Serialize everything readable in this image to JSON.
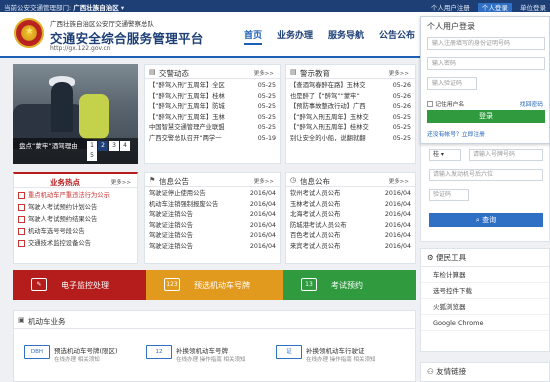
{
  "topbar": {
    "dept_label": "当前公安交通管理部门:",
    "dept_value": "广西壮族自治区",
    "links": [
      "个人用户注册",
      "个人登录",
      "单位登录"
    ]
  },
  "header": {
    "sub": "广西壮族自治区公安厅交通警察总队",
    "name": "交通安全综合服务管理平台",
    "url": "http://gx.122.gov.cn",
    "nav": [
      "首页",
      "业务办理",
      "服务导航",
      "公告公布"
    ]
  },
  "carousel": {
    "caption": "盘点“蒙牢”酒驾理由",
    "pages": [
      "1",
      "2",
      "3",
      "4",
      "5"
    ]
  },
  "jgdt": {
    "title": "交警动态",
    "more": "更多>>",
    "rows": [
      {
        "t": "【“醉驾入刑”五周年】全区",
        "d": "05-25"
      },
      {
        "t": "【“醉驾入刑”五周年】桂林",
        "d": "05-25"
      },
      {
        "t": "【“醉驾入刑”五周年】防城",
        "d": "05-25"
      },
      {
        "t": "【“醉驾入刑”五周年】玉林",
        "d": "05-25"
      },
      {
        "t": "中国智慧交通管理产业联盟",
        "d": "05-25"
      },
      {
        "t": "广西交警总队召开“两学一",
        "d": "05-19"
      }
    ]
  },
  "jsjy": {
    "title": "警示教育",
    "more": "更多>>",
    "rows": [
      {
        "t": "【查酒驾春醉在路】玉林交",
        "d": "05-26"
      },
      {
        "t": "也是醉了【“醉驾”“蒙牢”",
        "d": "05-26"
      },
      {
        "t": "【预防事故整改行动】广西",
        "d": "05-26"
      },
      {
        "t": "【“醉驾入刑五周年】玉林交",
        "d": "05-25"
      },
      {
        "t": "【“醉驾入刑五周年】桂林交",
        "d": "05-25"
      },
      {
        "t": "别让安全的小船，说翻就翻",
        "d": "05-25"
      }
    ]
  },
  "ywrd": {
    "title": "业务热点",
    "more": "更多>>",
    "rows": [
      "重点机动车严重违法行为公示",
      "驾驶人考试预约计划公告",
      "驾驶人考试预约结果公告",
      "机动车选号号段公告",
      "交通技术监控设备公告"
    ]
  },
  "xxgg": {
    "title": "信息公告",
    "more": "更多>>",
    "rows": [
      {
        "t": "驾驶证停止使用公告",
        "d": "2016/04"
      },
      {
        "t": "机动车注销强制报废公告",
        "d": "2016/04"
      },
      {
        "t": "驾驶证注销公告",
        "d": "2016/04"
      },
      {
        "t": "驾驶证注销公告",
        "d": "2016/04"
      },
      {
        "t": "驾驶证注销公告",
        "d": "2016/04"
      },
      {
        "t": "驾驶证注销公告",
        "d": "2016/04"
      }
    ]
  },
  "xxgb": {
    "title": "信息公布",
    "more": "更多>>",
    "rows": [
      {
        "t": "钦州考试人员公布",
        "d": "2016/04"
      },
      {
        "t": "玉林考试人员公布",
        "d": "2016/04"
      },
      {
        "t": "北海考试人员公布",
        "d": "2016/04"
      },
      {
        "t": "防城港考试人员公布",
        "d": "2016/04"
      },
      {
        "t": "百色考试人员公布",
        "d": "2016/04"
      },
      {
        "t": "来宾考试人员公布",
        "d": "2016/04"
      }
    ]
  },
  "bands": [
    {
      "label": "电子监控处理",
      "icon": "ticket"
    },
    {
      "label": "预选机动车号牌",
      "icon": "123"
    },
    {
      "label": "考试预约",
      "icon": "13"
    }
  ],
  "vehicle": {
    "title": "机动车业务",
    "items": [
      {
        "icon": "DBH",
        "title": "预选机动车号牌(限区)",
        "sub": "在线办理  相关须知"
      },
      {
        "icon": "12",
        "title": "补换领机动车号牌",
        "sub": "在线办理  操作指南  相关须知"
      },
      {
        "icon": "证",
        "title": "补换领机动车行驶证",
        "sub": "在线办理  操作指南  相关须知"
      }
    ]
  },
  "login": {
    "title": "个人用户登录",
    "id_placeholder": "输入注册填写的身份证明号码",
    "pwd_placeholder": "输入密码",
    "code_placeholder": "输入验证码",
    "remember": "记住用户名",
    "forgot": "找回密码",
    "btn": "登录",
    "tip": "还没有帐号？立即注册"
  },
  "query": {
    "select": "桂",
    "plate_placeholder": "请输入号牌号码",
    "vin_placeholder": "请输入发动机号后六位",
    "code_placeholder": "验证码",
    "btn": "查询"
  },
  "tools": {
    "title": "便民工具",
    "items": [
      "车检计算器",
      "选号控件下载",
      "火狐浏览器",
      "Google Chrome"
    ]
  },
  "links": {
    "title": "友情链接"
  },
  "colors": {
    "navy": "#1d3f76",
    "blue": "#1d5fb4",
    "red": "#b51d1d",
    "orange": "#e19a1d",
    "green": "#2f9a3e"
  }
}
